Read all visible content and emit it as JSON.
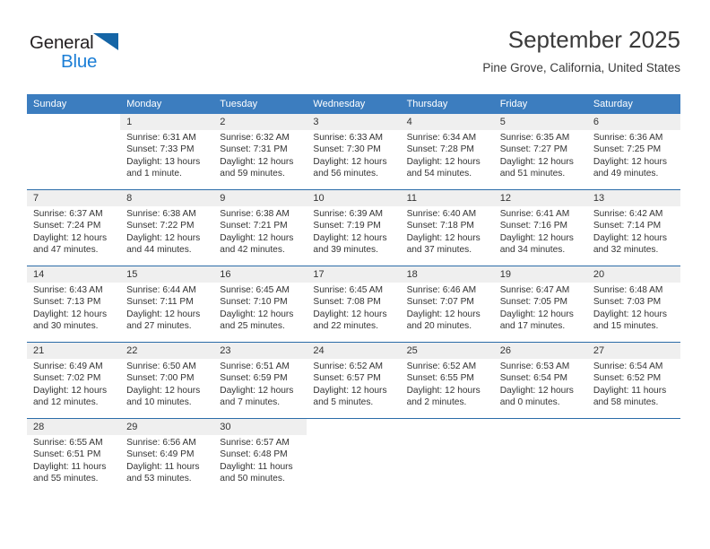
{
  "brand": {
    "name_part1": "General",
    "name_part2": "Blue",
    "triangle_color": "#1565a6",
    "blue_text_color": "#1b7ed6"
  },
  "header": {
    "title": "September 2025",
    "subtitle": "Pine Grove, California, United States"
  },
  "theme": {
    "header_row_bg": "#3c7dbf",
    "row_separator": "#2b6ca8",
    "daynum_band_bg": "#efefef",
    "text_color": "#333333"
  },
  "weekday_headers": [
    "Sunday",
    "Monday",
    "Tuesday",
    "Wednesday",
    "Thursday",
    "Friday",
    "Saturday"
  ],
  "weeks": [
    [
      {
        "day": "",
        "sunrise": "",
        "sunset": "",
        "daylight_line1": "",
        "daylight_line2": "",
        "empty": true
      },
      {
        "day": "1",
        "sunrise": "Sunrise: 6:31 AM",
        "sunset": "Sunset: 7:33 PM",
        "daylight_line1": "Daylight: 13 hours",
        "daylight_line2": "and 1 minute."
      },
      {
        "day": "2",
        "sunrise": "Sunrise: 6:32 AM",
        "sunset": "Sunset: 7:31 PM",
        "daylight_line1": "Daylight: 12 hours",
        "daylight_line2": "and 59 minutes."
      },
      {
        "day": "3",
        "sunrise": "Sunrise: 6:33 AM",
        "sunset": "Sunset: 7:30 PM",
        "daylight_line1": "Daylight: 12 hours",
        "daylight_line2": "and 56 minutes."
      },
      {
        "day": "4",
        "sunrise": "Sunrise: 6:34 AM",
        "sunset": "Sunset: 7:28 PM",
        "daylight_line1": "Daylight: 12 hours",
        "daylight_line2": "and 54 minutes."
      },
      {
        "day": "5",
        "sunrise": "Sunrise: 6:35 AM",
        "sunset": "Sunset: 7:27 PM",
        "daylight_line1": "Daylight: 12 hours",
        "daylight_line2": "and 51 minutes."
      },
      {
        "day": "6",
        "sunrise": "Sunrise: 6:36 AM",
        "sunset": "Sunset: 7:25 PM",
        "daylight_line1": "Daylight: 12 hours",
        "daylight_line2": "and 49 minutes."
      }
    ],
    [
      {
        "day": "7",
        "sunrise": "Sunrise: 6:37 AM",
        "sunset": "Sunset: 7:24 PM",
        "daylight_line1": "Daylight: 12 hours",
        "daylight_line2": "and 47 minutes."
      },
      {
        "day": "8",
        "sunrise": "Sunrise: 6:38 AM",
        "sunset": "Sunset: 7:22 PM",
        "daylight_line1": "Daylight: 12 hours",
        "daylight_line2": "and 44 minutes."
      },
      {
        "day": "9",
        "sunrise": "Sunrise: 6:38 AM",
        "sunset": "Sunset: 7:21 PM",
        "daylight_line1": "Daylight: 12 hours",
        "daylight_line2": "and 42 minutes."
      },
      {
        "day": "10",
        "sunrise": "Sunrise: 6:39 AM",
        "sunset": "Sunset: 7:19 PM",
        "daylight_line1": "Daylight: 12 hours",
        "daylight_line2": "and 39 minutes."
      },
      {
        "day": "11",
        "sunrise": "Sunrise: 6:40 AM",
        "sunset": "Sunset: 7:18 PM",
        "daylight_line1": "Daylight: 12 hours",
        "daylight_line2": "and 37 minutes."
      },
      {
        "day": "12",
        "sunrise": "Sunrise: 6:41 AM",
        "sunset": "Sunset: 7:16 PM",
        "daylight_line1": "Daylight: 12 hours",
        "daylight_line2": "and 34 minutes."
      },
      {
        "day": "13",
        "sunrise": "Sunrise: 6:42 AM",
        "sunset": "Sunset: 7:14 PM",
        "daylight_line1": "Daylight: 12 hours",
        "daylight_line2": "and 32 minutes."
      }
    ],
    [
      {
        "day": "14",
        "sunrise": "Sunrise: 6:43 AM",
        "sunset": "Sunset: 7:13 PM",
        "daylight_line1": "Daylight: 12 hours",
        "daylight_line2": "and 30 minutes."
      },
      {
        "day": "15",
        "sunrise": "Sunrise: 6:44 AM",
        "sunset": "Sunset: 7:11 PM",
        "daylight_line1": "Daylight: 12 hours",
        "daylight_line2": "and 27 minutes."
      },
      {
        "day": "16",
        "sunrise": "Sunrise: 6:45 AM",
        "sunset": "Sunset: 7:10 PM",
        "daylight_line1": "Daylight: 12 hours",
        "daylight_line2": "and 25 minutes."
      },
      {
        "day": "17",
        "sunrise": "Sunrise: 6:45 AM",
        "sunset": "Sunset: 7:08 PM",
        "daylight_line1": "Daylight: 12 hours",
        "daylight_line2": "and 22 minutes."
      },
      {
        "day": "18",
        "sunrise": "Sunrise: 6:46 AM",
        "sunset": "Sunset: 7:07 PM",
        "daylight_line1": "Daylight: 12 hours",
        "daylight_line2": "and 20 minutes."
      },
      {
        "day": "19",
        "sunrise": "Sunrise: 6:47 AM",
        "sunset": "Sunset: 7:05 PM",
        "daylight_line1": "Daylight: 12 hours",
        "daylight_line2": "and 17 minutes."
      },
      {
        "day": "20",
        "sunrise": "Sunrise: 6:48 AM",
        "sunset": "Sunset: 7:03 PM",
        "daylight_line1": "Daylight: 12 hours",
        "daylight_line2": "and 15 minutes."
      }
    ],
    [
      {
        "day": "21",
        "sunrise": "Sunrise: 6:49 AM",
        "sunset": "Sunset: 7:02 PM",
        "daylight_line1": "Daylight: 12 hours",
        "daylight_line2": "and 12 minutes."
      },
      {
        "day": "22",
        "sunrise": "Sunrise: 6:50 AM",
        "sunset": "Sunset: 7:00 PM",
        "daylight_line1": "Daylight: 12 hours",
        "daylight_line2": "and 10 minutes."
      },
      {
        "day": "23",
        "sunrise": "Sunrise: 6:51 AM",
        "sunset": "Sunset: 6:59 PM",
        "daylight_line1": "Daylight: 12 hours",
        "daylight_line2": "and 7 minutes."
      },
      {
        "day": "24",
        "sunrise": "Sunrise: 6:52 AM",
        "sunset": "Sunset: 6:57 PM",
        "daylight_line1": "Daylight: 12 hours",
        "daylight_line2": "and 5 minutes."
      },
      {
        "day": "25",
        "sunrise": "Sunrise: 6:52 AM",
        "sunset": "Sunset: 6:55 PM",
        "daylight_line1": "Daylight: 12 hours",
        "daylight_line2": "and 2 minutes."
      },
      {
        "day": "26",
        "sunrise": "Sunrise: 6:53 AM",
        "sunset": "Sunset: 6:54 PM",
        "daylight_line1": "Daylight: 12 hours",
        "daylight_line2": "and 0 minutes."
      },
      {
        "day": "27",
        "sunrise": "Sunrise: 6:54 AM",
        "sunset": "Sunset: 6:52 PM",
        "daylight_line1": "Daylight: 11 hours",
        "daylight_line2": "and 58 minutes."
      }
    ],
    [
      {
        "day": "28",
        "sunrise": "Sunrise: 6:55 AM",
        "sunset": "Sunset: 6:51 PM",
        "daylight_line1": "Daylight: 11 hours",
        "daylight_line2": "and 55 minutes."
      },
      {
        "day": "29",
        "sunrise": "Sunrise: 6:56 AM",
        "sunset": "Sunset: 6:49 PM",
        "daylight_line1": "Daylight: 11 hours",
        "daylight_line2": "and 53 minutes."
      },
      {
        "day": "30",
        "sunrise": "Sunrise: 6:57 AM",
        "sunset": "Sunset: 6:48 PM",
        "daylight_line1": "Daylight: 11 hours",
        "daylight_line2": "and 50 minutes."
      },
      {
        "day": "",
        "sunrise": "",
        "sunset": "",
        "daylight_line1": "",
        "daylight_line2": "",
        "empty": true
      },
      {
        "day": "",
        "sunrise": "",
        "sunset": "",
        "daylight_line1": "",
        "daylight_line2": "",
        "empty": true
      },
      {
        "day": "",
        "sunrise": "",
        "sunset": "",
        "daylight_line1": "",
        "daylight_line2": "",
        "empty": true
      },
      {
        "day": "",
        "sunrise": "",
        "sunset": "",
        "daylight_line1": "",
        "daylight_line2": "",
        "empty": true
      }
    ]
  ]
}
